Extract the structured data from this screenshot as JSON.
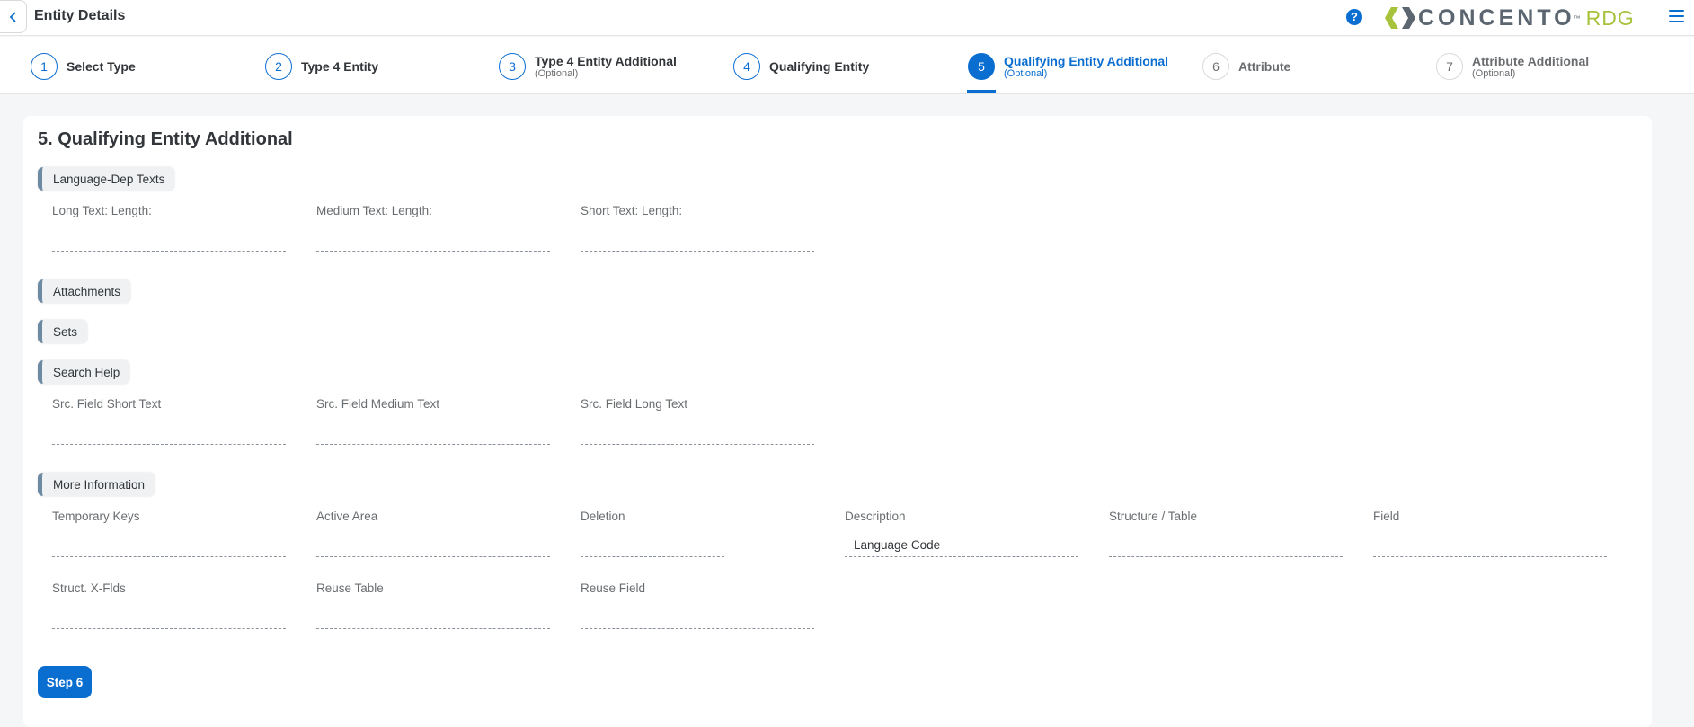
{
  "header": {
    "title": "Entity Details",
    "help_icon": "?",
    "logo": {
      "name": "CONCENTO",
      "tm": "™",
      "suffix": "RDG"
    },
    "colors": {
      "accent": "#0a6ed1",
      "logo_gray": "#5b6670",
      "logo_green": "#a7c23b"
    }
  },
  "wizard": {
    "steps": [
      {
        "number": "1",
        "label": "Select Type",
        "optional": ""
      },
      {
        "number": "2",
        "label": "Type 4 Entity",
        "optional": ""
      },
      {
        "number": "3",
        "label": "Type 4 Entity Additional",
        "optional": "(Optional)"
      },
      {
        "number": "4",
        "label": "Qualifying Entity",
        "optional": ""
      },
      {
        "number": "5",
        "label": "Qualifying Entity Additional",
        "optional": "(Optional)"
      },
      {
        "number": "6",
        "label": "Attribute",
        "optional": ""
      },
      {
        "number": "7",
        "label": "Attribute Additional",
        "optional": "(Optional)"
      }
    ],
    "active_step": 5
  },
  "main": {
    "title": "5. Qualifying Entity Additional",
    "groups": {
      "language": "Language-Dep Texts",
      "attachments": "Attachments",
      "sets": "Sets",
      "search_help": "Search Help",
      "more_info": "More Information"
    },
    "fields": {
      "long_text_length": {
        "label": "Long Text: Length:",
        "value": ""
      },
      "medium_text_length": {
        "label": "Medium Text: Length:",
        "value": ""
      },
      "short_text_length": {
        "label": "Short Text: Length:",
        "value": ""
      },
      "src_field_short": {
        "label": "Src. Field Short Text",
        "value": ""
      },
      "src_field_medium": {
        "label": "Src. Field Medium Text",
        "value": ""
      },
      "src_field_long": {
        "label": "Src. Field Long Text",
        "value": ""
      },
      "temporary_keys": {
        "label": "Temporary Keys",
        "value": ""
      },
      "active_area": {
        "label": "Active Area",
        "value": ""
      },
      "deletion": {
        "label": "Deletion",
        "value": ""
      },
      "description": {
        "label": "Description",
        "value": "Language Code"
      },
      "structure_table": {
        "label": "Structure / Table",
        "value": ""
      },
      "field": {
        "label": "Field",
        "value": ""
      },
      "struct_x_flds": {
        "label": "Struct. X-Flds",
        "value": ""
      },
      "reuse_table": {
        "label": "Reuse Table",
        "value": ""
      },
      "reuse_field": {
        "label": "Reuse Field",
        "value": ""
      }
    },
    "next_button": "Step 6"
  }
}
